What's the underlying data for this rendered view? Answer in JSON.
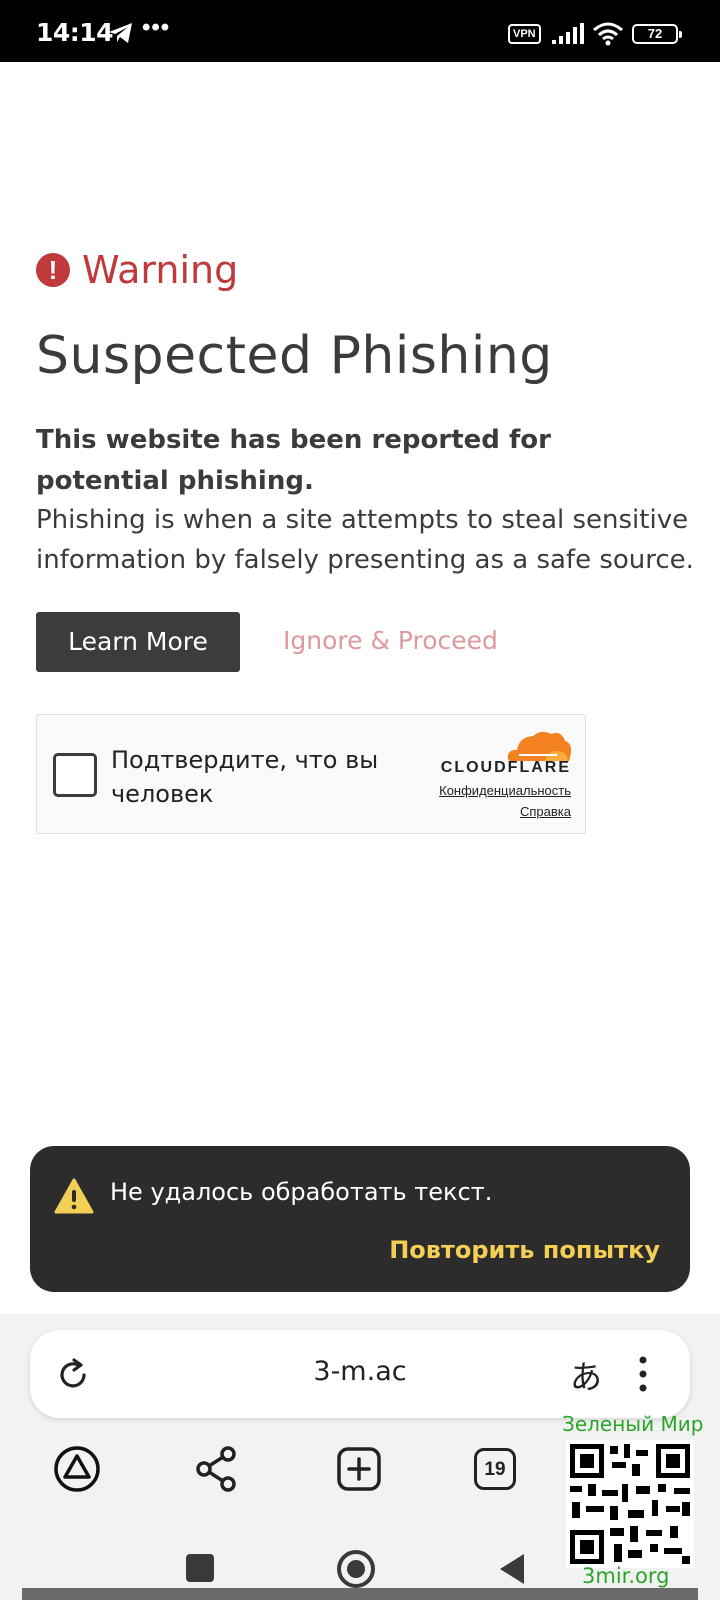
{
  "status_bar": {
    "time": "14:14",
    "dots": "•••",
    "vpn": "VPN",
    "battery": "72"
  },
  "warning_page": {
    "warning_label": "Warning",
    "warning_icon": "!",
    "title": "Suspected Phishing",
    "bold_description": "This website has been reported for potential phishing.",
    "description": "Phishing is when a site attempts to steal sensitive information by falsely presenting as a safe source.",
    "learn_more_label": "Learn More",
    "ignore_label": "Ignore & Proceed",
    "accent_color": "#c0393b"
  },
  "cloudflare": {
    "checkbox_label": "Подтвердите, что вы человек",
    "logo_text": "CLOUDFLARE",
    "privacy_link": "Конфиденциальность",
    "help_link": "Справка",
    "checked": false
  },
  "toast": {
    "message": "Не удалось обработать текст.",
    "action": "Повторить попытку",
    "icon": "warning-triangle-icon"
  },
  "browser": {
    "url": "3-m.ac",
    "translate_glyph": "あ",
    "tabs_count": "19"
  },
  "watermark": {
    "top_text": "Зеленый Мир",
    "bottom_text": "3mir.org"
  }
}
